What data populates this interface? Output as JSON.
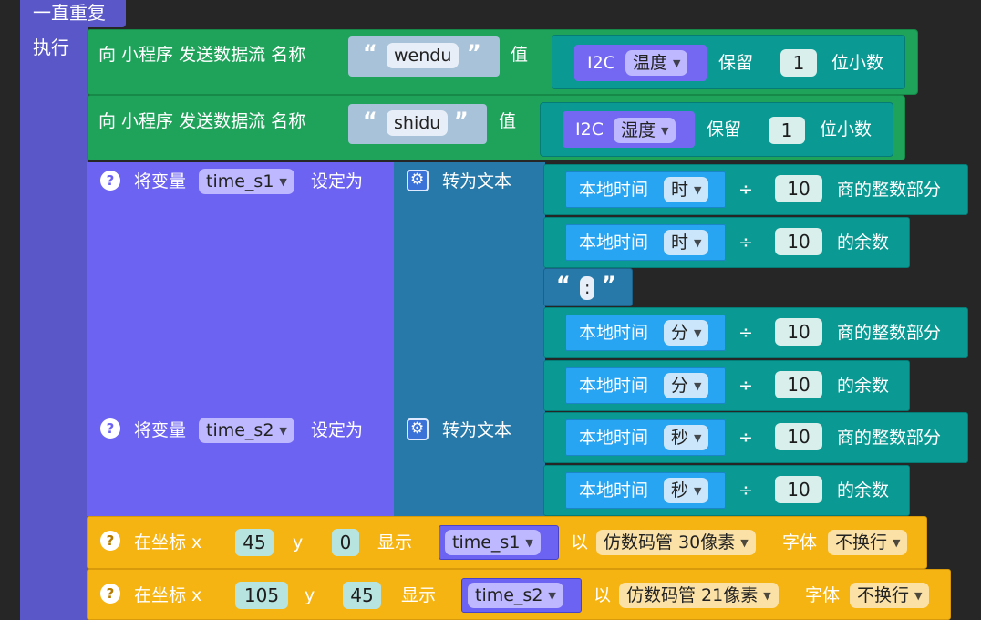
{
  "forever_block": {
    "label": "一直重复",
    "do_label": "执行"
  },
  "send_blocks": [
    {
      "prefix": "向 小程序 发送数据流 名称",
      "name": "wendu",
      "value_label": "值",
      "sensor": "I2C",
      "sensor_option": "温度",
      "keep_label": "保留",
      "decimals": "1",
      "suffix": "位小数"
    },
    {
      "prefix": "向 小程序 发送数据流 名称",
      "name": "shidu",
      "value_label": "值",
      "sensor": "I2C",
      "sensor_option": "湿度",
      "keep_label": "保留",
      "decimals": "1",
      "suffix": "位小数"
    }
  ],
  "set_blocks": [
    {
      "help": "?",
      "prefix": "将变量",
      "variable": "time_s1",
      "suffix": "设定为",
      "to_text": "转为文本"
    },
    {
      "help": "?",
      "prefix": "将变量",
      "variable": "time_s2",
      "suffix": "设定为",
      "to_text": "转为文本"
    }
  ],
  "time_rows": [
    {
      "label": "本地时间",
      "unit": "时",
      "op": "÷",
      "divisor": "10",
      "result": "商的整数部分"
    },
    {
      "label": "本地时间",
      "unit": "时",
      "op": "÷",
      "divisor": "10",
      "result": "的余数"
    },
    {
      "label": "本地时间",
      "unit": "分",
      "op": "÷",
      "divisor": "10",
      "result": "商的整数部分"
    },
    {
      "label": "本地时间",
      "unit": "分",
      "op": "÷",
      "divisor": "10",
      "result": "的余数"
    },
    {
      "label": "本地时间",
      "unit": "秒",
      "op": "÷",
      "divisor": "10",
      "result": "商的整数部分"
    },
    {
      "label": "本地时间",
      "unit": "秒",
      "op": "÷",
      "divisor": "10",
      "result": "的余数"
    }
  ],
  "colon_text": {
    "open": "“",
    "value": ":",
    "close": "”"
  },
  "display_blocks": [
    {
      "help": "?",
      "prefix": "在坐标 x",
      "x": "45",
      "y_label": "y",
      "y": "0",
      "show_label": "显示",
      "variable": "time_s1",
      "with_label": "以",
      "font": "仿数码管 30像素",
      "font_label": "字体",
      "wrap": "不换行"
    },
    {
      "help": "?",
      "prefix": "在坐标 x",
      "x": "105",
      "y_label": "y",
      "y": "45",
      "show_label": "显示",
      "variable": "time_s2",
      "with_label": "以",
      "font": "仿数码管 21像素",
      "font_label": "字体",
      "wrap": "不换行"
    }
  ],
  "colors": {
    "purple": "#5a57c8",
    "green": "#1fa35a",
    "variable": "#6d63f2",
    "text_block": "#2779a9",
    "math": "#0b9a93",
    "time": "#27a4f2",
    "display": "#f6b413",
    "background": "#262627"
  },
  "icons": {
    "help": "question-circle-icon",
    "gear": "gear-icon",
    "dropdown": "triangle-down-icon"
  }
}
